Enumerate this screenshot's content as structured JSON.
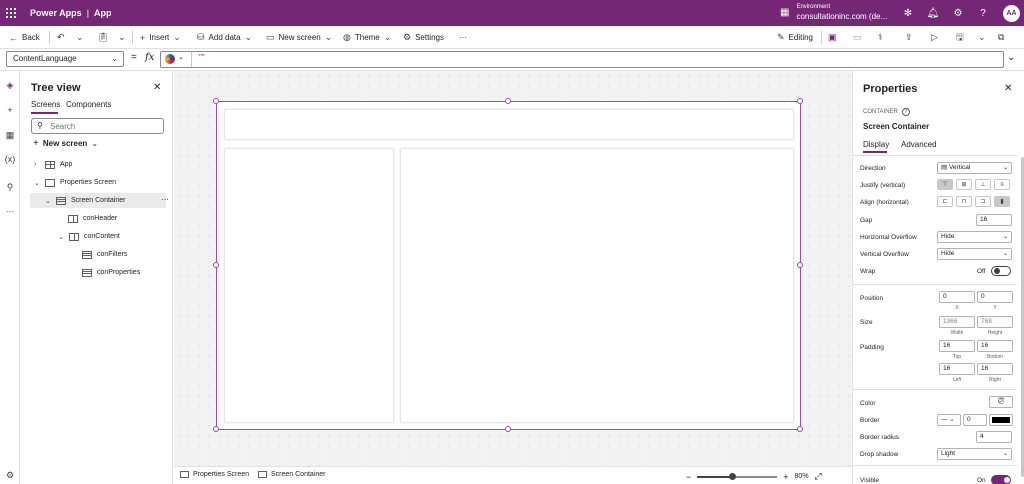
{
  "topbar": {
    "app_name": "Power Apps",
    "separator": "|",
    "app_section": "App",
    "env_label": "Environment",
    "env_value": "consultationinc.com (de...",
    "avatar_initials": "AA"
  },
  "commandbar": {
    "back": "Back",
    "insert": "Insert",
    "add_data": "Add data",
    "new_screen": "New screen",
    "theme": "Theme",
    "settings": "Settings",
    "more": "···",
    "editing": "Editing"
  },
  "formula": {
    "property": "ContentLanguage",
    "equals": "=",
    "fx": "fx",
    "value": "\"\""
  },
  "tree": {
    "title": "Tree view",
    "tabs": [
      "Screens",
      "Components"
    ],
    "search_placeholder": "Search",
    "new_screen": "New screen",
    "nodes": [
      {
        "label": "App"
      },
      {
        "label": "Properties Screen"
      },
      {
        "label": "Screen Container"
      },
      {
        "label": "conHeader"
      },
      {
        "label": "conContent"
      },
      {
        "label": "conFilters"
      },
      {
        "label": "conProperties"
      }
    ]
  },
  "statusbar": {
    "crumb1": "Properties Screen",
    "crumb2": "Screen Container",
    "zoom": "80%",
    "zoom_level": 0.43
  },
  "properties": {
    "title": "Properties",
    "type": "CONTAINER",
    "name": "Screen Container",
    "tabs": [
      "Display",
      "Advanced"
    ],
    "direction_label": "Direction",
    "direction_value": "Vertical",
    "justify_label": "Justify (vertical)",
    "align_label": "Align (horizontal)",
    "gap_label": "Gap",
    "gap_value": "16",
    "hoverflow_label": "Horizontal Overflow",
    "hoverflow_value": "Hide",
    "voverflow_label": "Vertical Overflow",
    "voverflow_value": "Hide",
    "wrap_label": "Wrap",
    "wrap_value": "Off",
    "position_label": "Position",
    "pos_x": "0",
    "pos_y": "0",
    "cap_x": "X",
    "cap_y": "Y",
    "size_label": "Size",
    "width": "1366",
    "height": "768",
    "cap_width": "Width",
    "cap_height": "Height",
    "padding_label": "Padding",
    "pad_top": "16",
    "pad_bottom": "16",
    "pad_left": "16",
    "pad_right": "16",
    "cap_top": "Top",
    "cap_bottom": "Bottom",
    "cap_left": "Left",
    "cap_right": "Right",
    "color_label": "Color",
    "border_label": "Border",
    "border_value": "0",
    "border_color": "#000000",
    "radius_label": "Border radius",
    "radius_value": "4",
    "shadow_label": "Drop shadow",
    "shadow_value": "Light",
    "visible_label": "Visible",
    "visible_value": "On"
  },
  "colors": {
    "brand": "#742774",
    "selection": "#a24ba2"
  }
}
